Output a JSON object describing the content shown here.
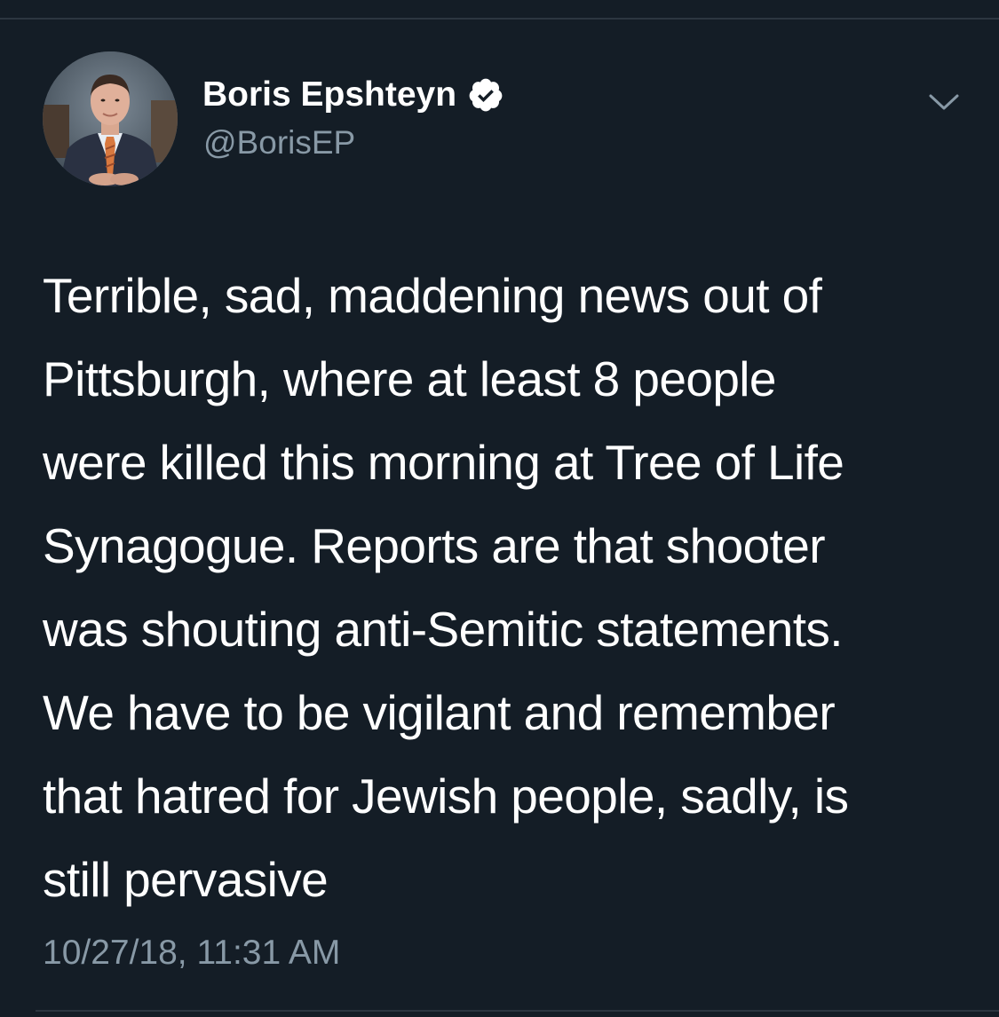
{
  "user": {
    "display_name": "Boris Epshteyn",
    "handle": "@BorisEP",
    "verified": true
  },
  "tweet": {
    "lines": [
      "Terrible, sad, maddening news out of",
      "Pittsburgh, where at least 8 people",
      "were killed this morning at Tree of Life",
      "Synagogue. Reports are that shooter",
      "was shouting anti-Semitic statements.",
      "We have to be vigilant and remember",
      "that hatred for Jewish people, sadly, is",
      "still pervasive"
    ],
    "timestamp": "10/27/18, 11:31 AM"
  },
  "icons": {
    "avatar": "avatar-photo",
    "verified": "verified-badge-icon",
    "more": "chevron-down-icon"
  },
  "colors": {
    "background": "#141d26",
    "text_primary": "#ffffff",
    "text_secondary": "#8899a6",
    "divider": "#2c3640"
  }
}
